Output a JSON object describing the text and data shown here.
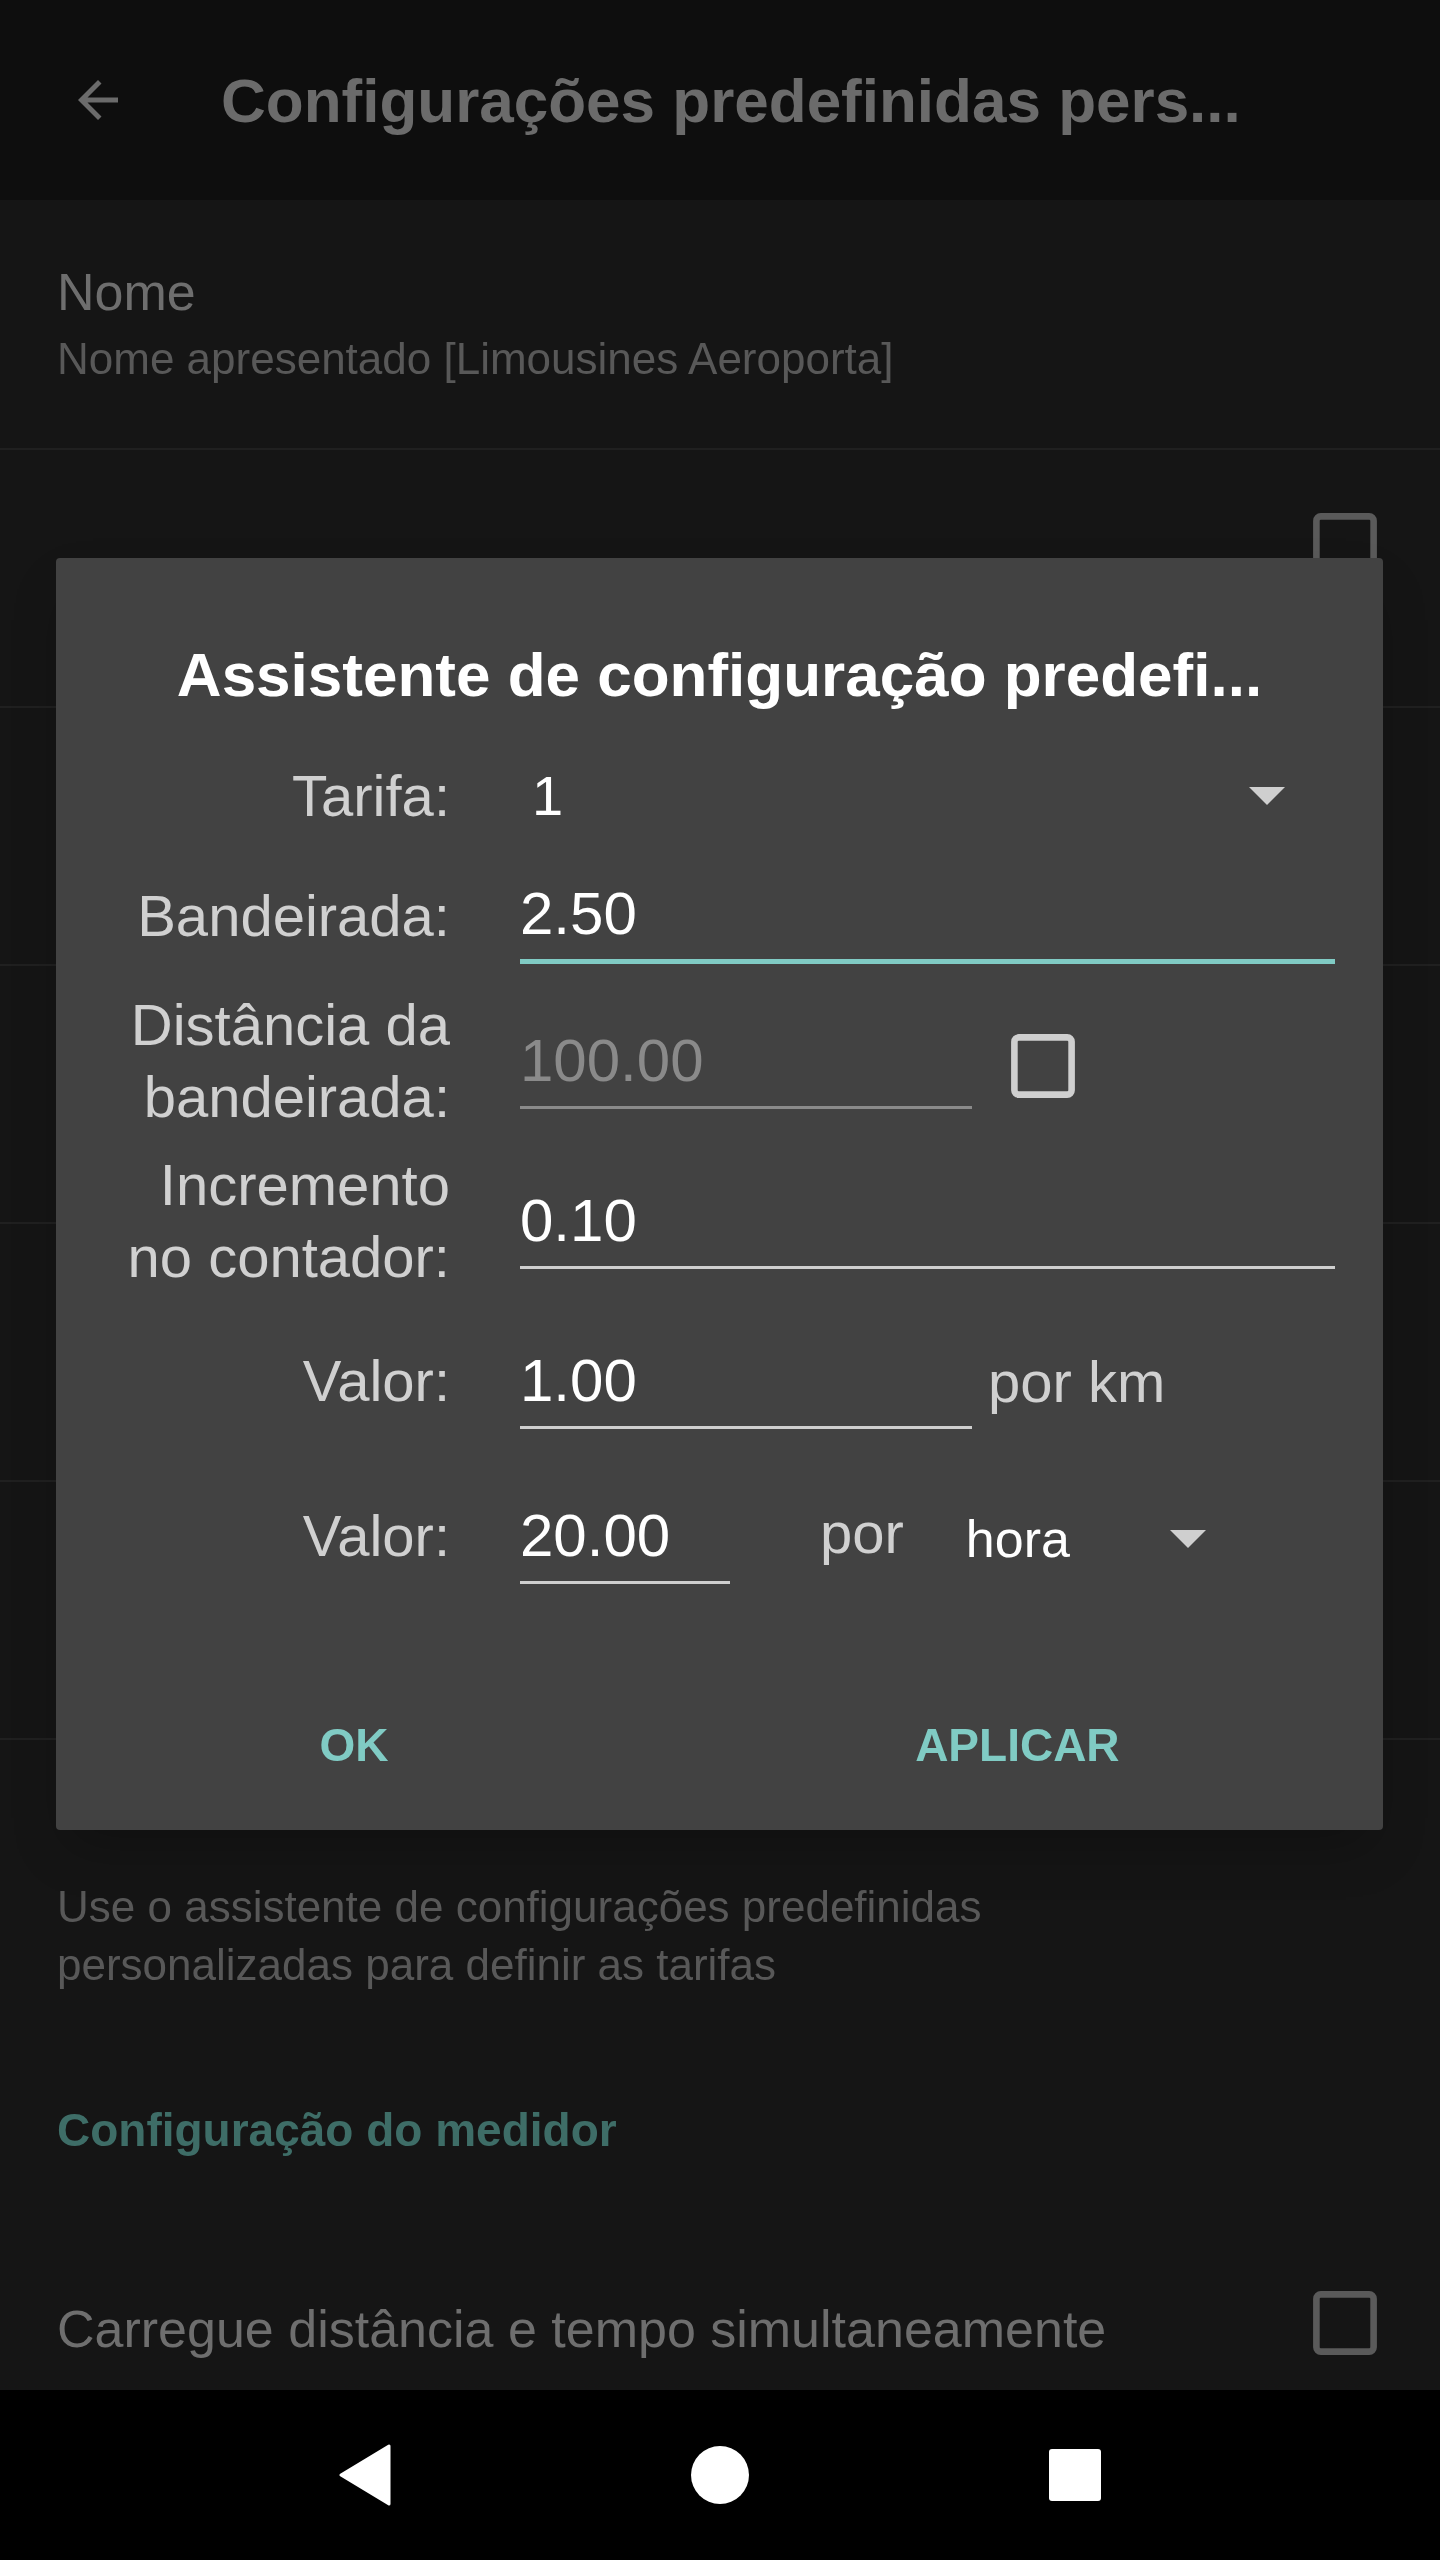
{
  "app_bar": {
    "title": "Configurações predefinidas pers..."
  },
  "settings": [
    {
      "kind": "text",
      "title": "Nome",
      "summary": "Nome apresentado [Limousines Aeroporta]"
    },
    {
      "kind": "checkbox",
      "checked": false
    },
    {
      "kind": "blank"
    },
    {
      "kind": "blank"
    },
    {
      "kind": "blank"
    },
    {
      "kind": "blank"
    },
    {
      "kind": "text",
      "summary": "Use o assistente de configurações predefinidas personalizadas para definir as tarifas"
    },
    {
      "kind": "category",
      "title": "Configuração do medidor"
    },
    {
      "kind": "checkbox",
      "title": "Carregue distância e tempo simultaneamente",
      "checked": false
    }
  ],
  "dialog": {
    "title": "Assistente de configuração predefi...",
    "rows": [
      {
        "kind": "dropdown",
        "label": "Tarifa:",
        "value": "1"
      },
      {
        "kind": "field",
        "label": "Bandeirada:",
        "value": "2.50",
        "focused": true
      },
      {
        "kind": "field_checkbox",
        "label": "Distância da bandeirada:",
        "value": "100.00",
        "disabled": true,
        "checked": false
      },
      {
        "kind": "field",
        "label": "Incremento no contador:",
        "value": "0.10",
        "focused": false
      },
      {
        "kind": "field_suffix",
        "label": "Valor:",
        "value": "1.00",
        "suffix": "por km"
      },
      {
        "kind": "field_dropdown",
        "label": "Valor:",
        "value": "20.00",
        "word": "por",
        "option": "hora"
      }
    ],
    "buttons": [
      "OK",
      "APLICAR"
    ]
  }
}
